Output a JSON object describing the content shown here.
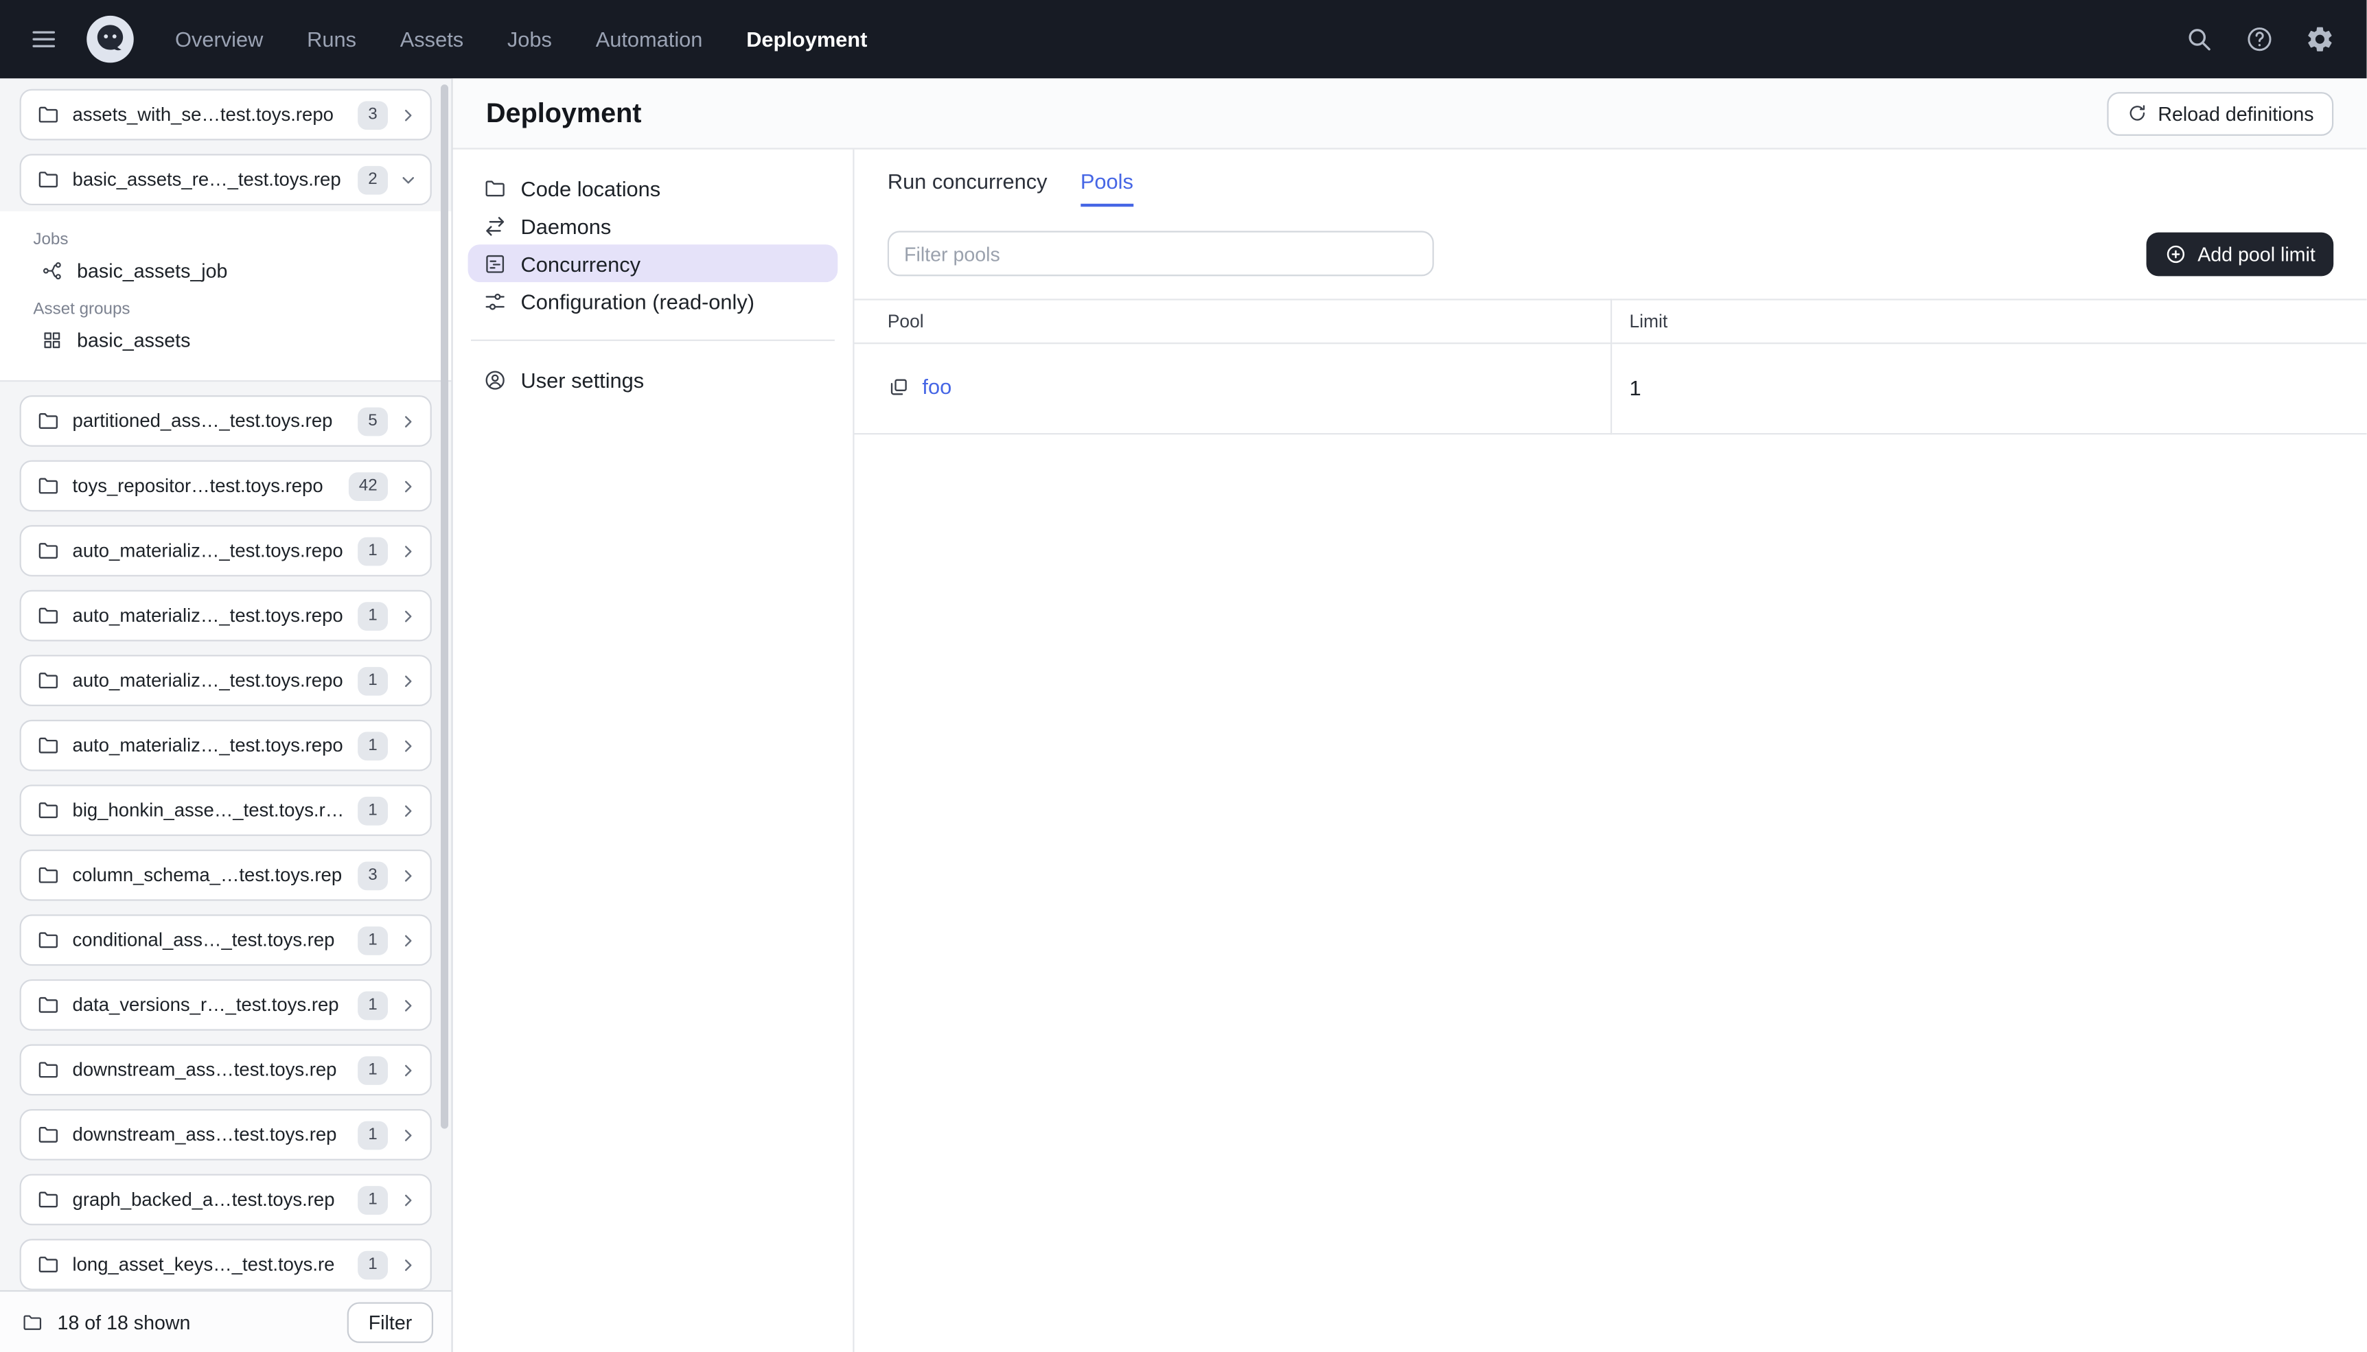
{
  "colors": {
    "topnav_bg": "#171B24",
    "accent_blue": "#4666E5",
    "selected_item_bg": "#E5E2F9"
  },
  "topnav": {
    "nav_items": [
      {
        "label": "Overview",
        "active": false
      },
      {
        "label": "Runs",
        "active": false
      },
      {
        "label": "Assets",
        "active": false
      },
      {
        "label": "Jobs",
        "active": false
      },
      {
        "label": "Automation",
        "active": false
      },
      {
        "label": "Deployment",
        "active": true
      }
    ]
  },
  "sidebar": {
    "repos": [
      {
        "name": "assets_with_se…test.toys.repo",
        "count": "3"
      },
      {
        "name": "basic_assets_re…_test.toys.rep",
        "count": "2"
      },
      {
        "name": "partitioned_ass…_test.toys.rep",
        "count": "5"
      },
      {
        "name": "toys_repositor…test.toys.repo",
        "count": "42"
      },
      {
        "name": "auto_materializ…_test.toys.repo",
        "count": "1"
      },
      {
        "name": "auto_materializ…_test.toys.repo",
        "count": "1"
      },
      {
        "name": "auto_materializ…_test.toys.repo",
        "count": "1"
      },
      {
        "name": "auto_materializ…_test.toys.repo",
        "count": "1"
      },
      {
        "name": "big_honkin_asse…_test.toys.rep",
        "count": "1"
      },
      {
        "name": "column_schema_…test.toys.rep",
        "count": "3"
      },
      {
        "name": "conditional_ass…_test.toys.rep",
        "count": "1"
      },
      {
        "name": "data_versions_r…_test.toys.rep",
        "count": "1"
      },
      {
        "name": "downstream_ass…test.toys.rep",
        "count": "1"
      },
      {
        "name": "downstream_ass…test.toys.rep",
        "count": "1"
      },
      {
        "name": "graph_backed_a…test.toys.rep",
        "count": "1"
      },
      {
        "name": "long_asset_keys…_test.toys.re",
        "count": "1"
      }
    ],
    "expanded": {
      "jobs_label": "Jobs",
      "job_name": "basic_assets_job",
      "asset_groups_label": "Asset groups",
      "asset_group_name": "basic_assets"
    },
    "footer": {
      "shown_text": "18 of 18 shown",
      "filter_label": "Filter"
    }
  },
  "page": {
    "title": "Deployment",
    "reload_button_label": "Reload definitions"
  },
  "settings_nav": {
    "items": [
      {
        "label": "Code locations",
        "selected": false
      },
      {
        "label": "Daemons",
        "selected": false
      },
      {
        "label": "Concurrency",
        "selected": true
      },
      {
        "label": "Configuration (read-only)",
        "selected": false
      },
      {
        "label": "User settings",
        "selected": false
      }
    ]
  },
  "concurrency": {
    "tabs": [
      {
        "label": "Run concurrency",
        "active": false
      },
      {
        "label": "Pools",
        "active": true
      }
    ],
    "filter_placeholder": "Filter pools",
    "add_pool_button_label": "Add pool limit",
    "table": {
      "columns": [
        "Pool",
        "Limit"
      ],
      "rows": [
        {
          "pool": "foo",
          "limit": "1"
        }
      ]
    }
  }
}
